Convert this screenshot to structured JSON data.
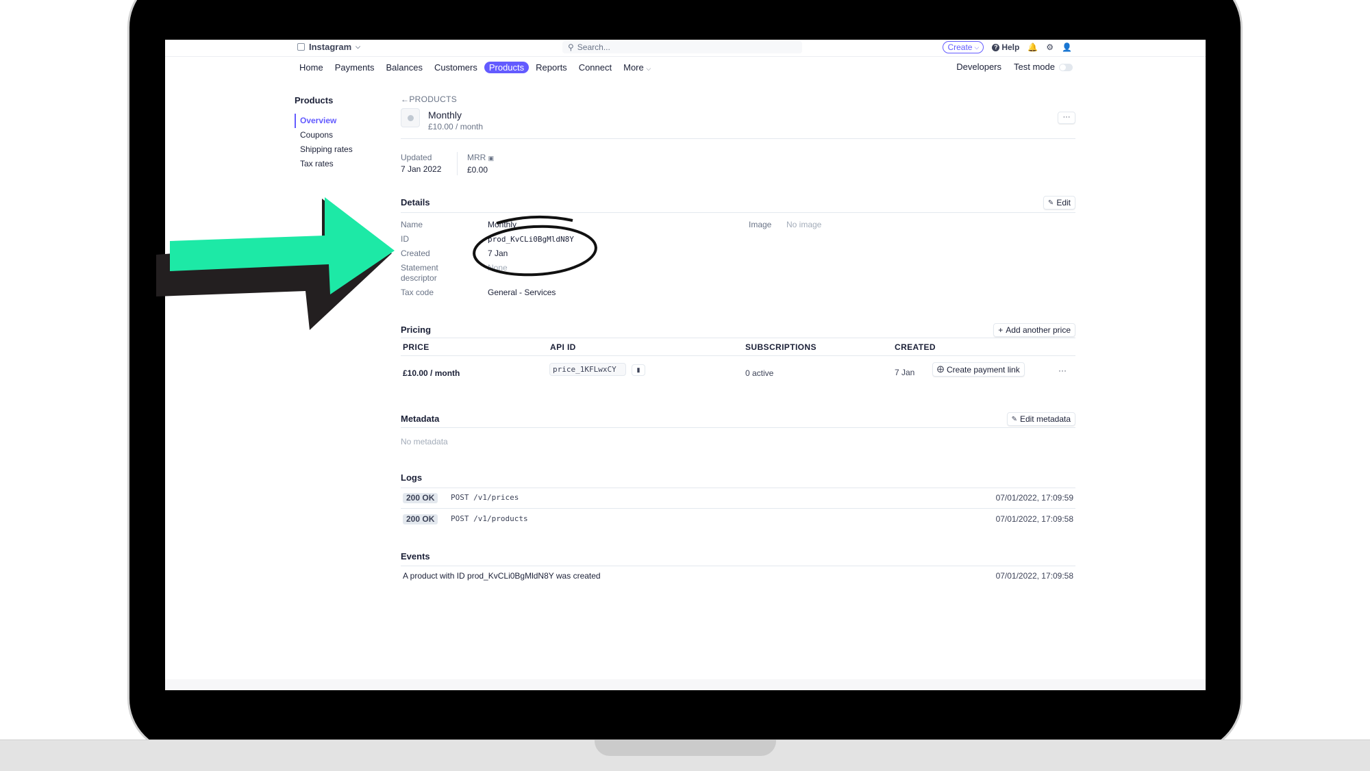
{
  "topbar": {
    "account_name": "Instagram",
    "search_placeholder": "Search...",
    "create_label": "Create",
    "help_label": "Help"
  },
  "nav": {
    "tabs": [
      "Home",
      "Payments",
      "Balances",
      "Customers",
      "Products",
      "Reports",
      "Connect",
      "More"
    ],
    "active_tab": "Products",
    "developers_label": "Developers",
    "test_mode_label": "Test mode"
  },
  "sidebar": {
    "title": "Products",
    "items": [
      "Overview",
      "Coupons",
      "Shipping rates",
      "Tax rates"
    ],
    "active_item": "Overview"
  },
  "product": {
    "breadcrumb": "PRODUCTS",
    "name": "Monthly",
    "price": "£10.00 / month",
    "updated_label": "Updated",
    "updated_value": "7 Jan 2022",
    "mrr_label": "MRR",
    "mrr_value": "£0.00"
  },
  "details": {
    "title": "Details",
    "edit_label": "Edit",
    "name_label": "Name",
    "name_value": "Monthly",
    "id_label": "ID",
    "id_value": "prod_KvCLi0BgMldN8Y",
    "created_label": "Created",
    "created_value": "7 Jan",
    "statement_label": "Statement descriptor",
    "statement_value": "None",
    "tax_label": "Tax code",
    "tax_value": "General - Services",
    "image_label": "Image",
    "image_value": "No image"
  },
  "pricing": {
    "title": "Pricing",
    "add_label": "Add another price",
    "headers": [
      "PRICE",
      "API ID",
      "SUBSCRIPTIONS",
      "CREATED"
    ],
    "row": {
      "price": "£10.00 / month",
      "api_id": "price_1KFLwxCY",
      "subscriptions": "0 active",
      "created": "7 Jan",
      "payment_link_label": "Create payment link"
    }
  },
  "metadata": {
    "title": "Metadata",
    "edit_label": "Edit metadata",
    "empty_text": "No metadata"
  },
  "logs": {
    "title": "Logs",
    "entries": [
      {
        "status": "200 OK",
        "path": "POST /v1/prices",
        "time": "07/01/2022, 17:09:59"
      },
      {
        "status": "200 OK",
        "path": "POST /v1/products",
        "time": "07/01/2022, 17:09:58"
      }
    ]
  },
  "events": {
    "title": "Events",
    "entries": [
      {
        "text": "A product with ID prod_KvCLi0BgMldN8Y was created",
        "time": "07/01/2022, 17:09:58"
      }
    ]
  },
  "annotation": {
    "arrow_color": "#1de9a6",
    "circle_color": "#111111"
  }
}
